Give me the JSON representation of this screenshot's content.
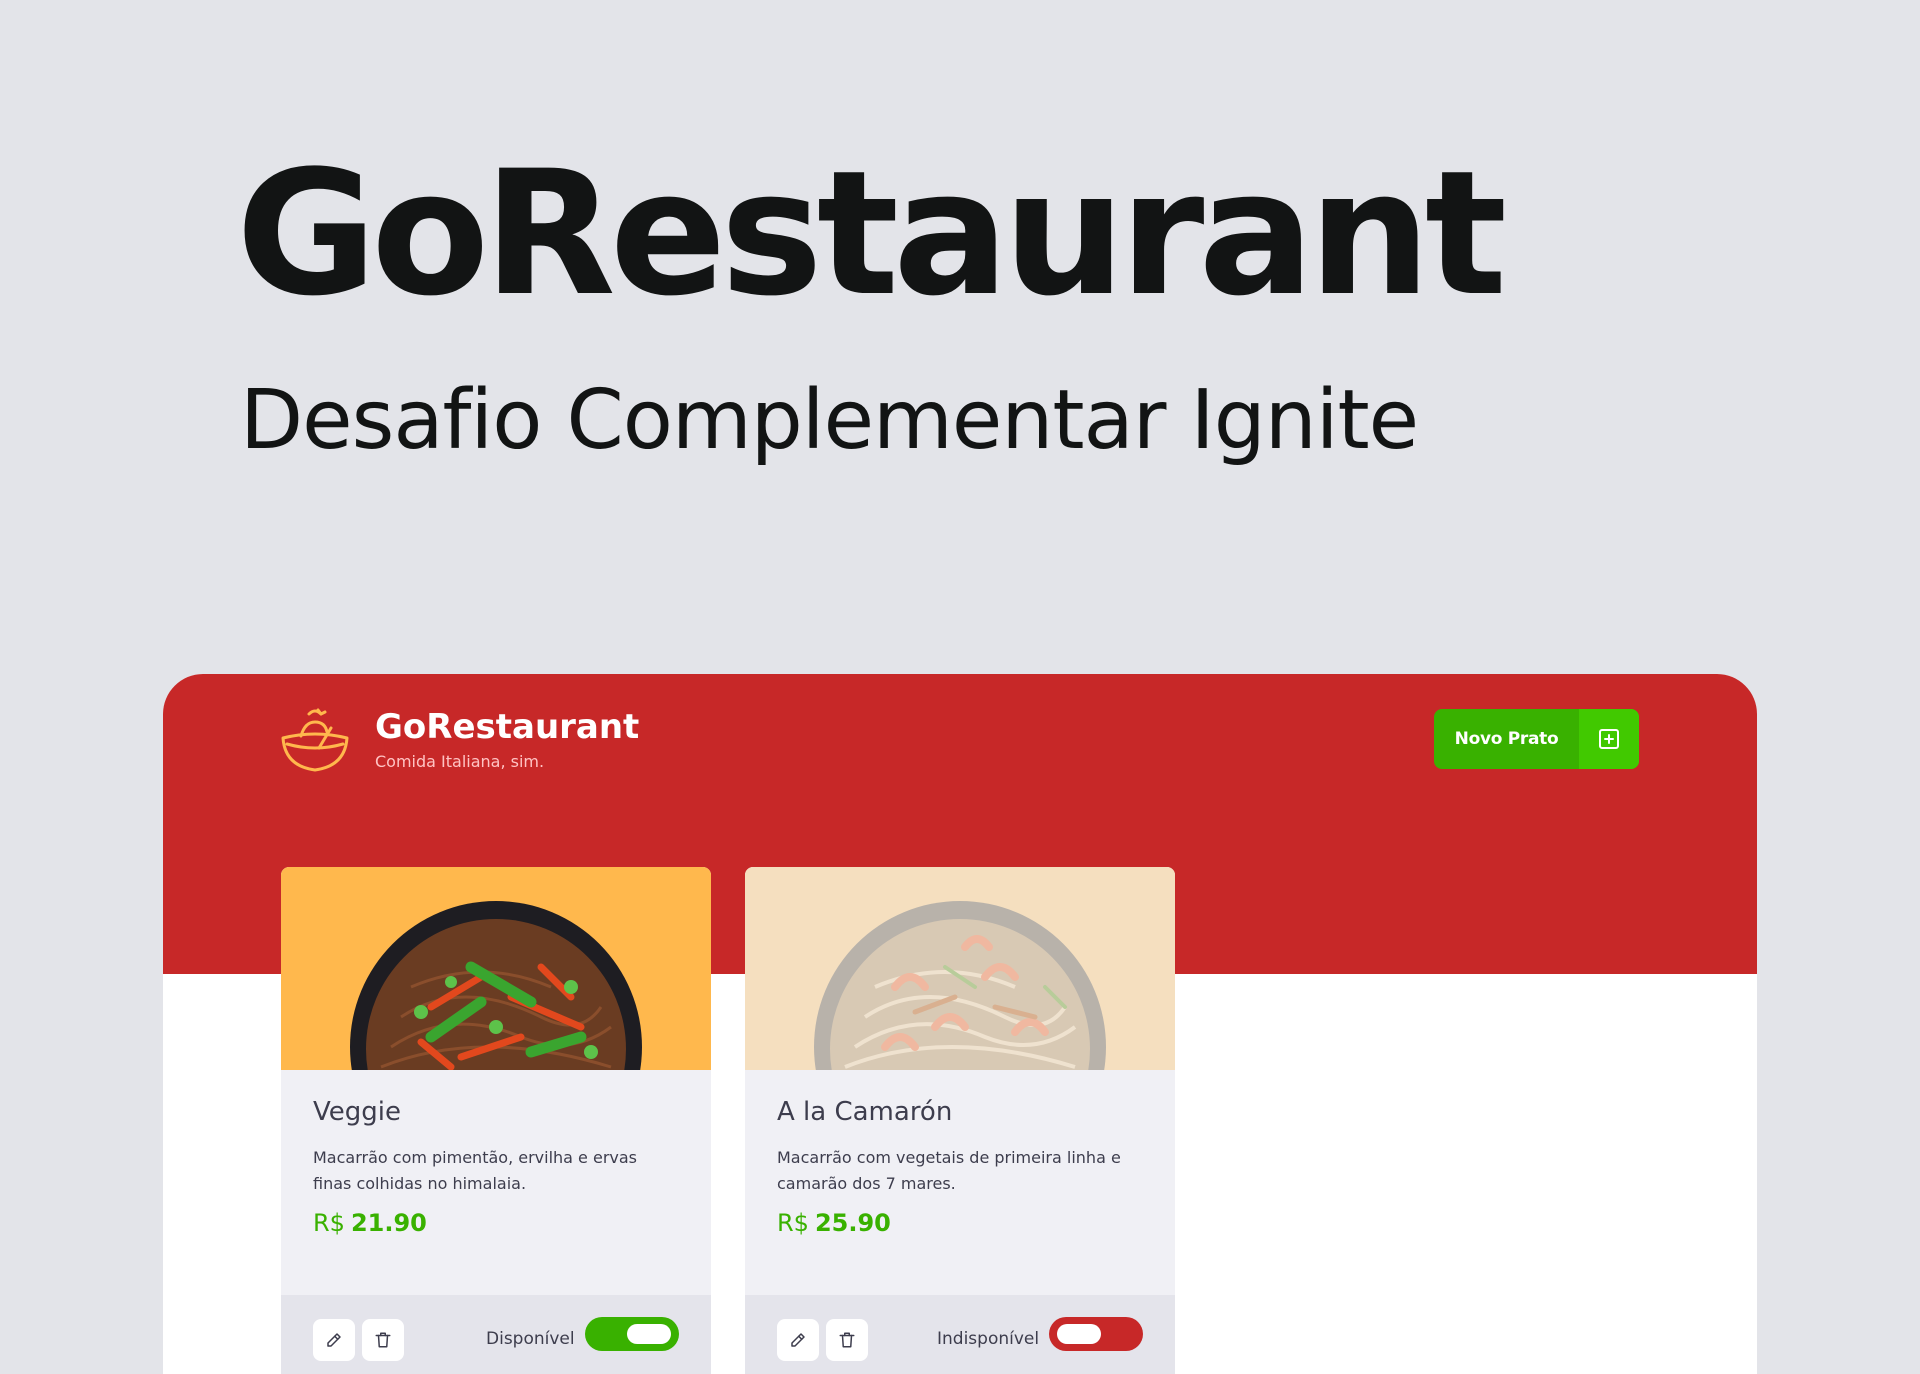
{
  "hero": {
    "title": "GoRestaurant",
    "subtitle": "Desafio Complementar Ignite"
  },
  "app": {
    "logo_icon": "bowl-icon",
    "title": "GoRestaurant",
    "tagline": "Comida Italiana, sim.",
    "new_dish_button": {
      "label": "Novo Prato",
      "icon": "plus-square-icon"
    },
    "colors": {
      "header": "#c72828",
      "accent_green": "#39b100",
      "accent_green_light": "#41c900",
      "unavailable_red": "#c72828"
    },
    "dishes": [
      {
        "name": "Veggie",
        "description": "Macarrão com pimentão, ervilha e ervas finas colhidas no himalaia.",
        "currency": "R$",
        "price": "21.90",
        "status_label": "Disponível",
        "available": true,
        "edit_icon": "pencil-icon",
        "delete_icon": "trash-icon"
      },
      {
        "name": "A la Camarón",
        "description": "Macarrão com vegetais de primeira linha e camarão dos 7 mares.",
        "currency": "R$",
        "price": "25.90",
        "status_label": "Indisponível",
        "available": false,
        "edit_icon": "pencil-icon",
        "delete_icon": "trash-icon"
      }
    ]
  }
}
